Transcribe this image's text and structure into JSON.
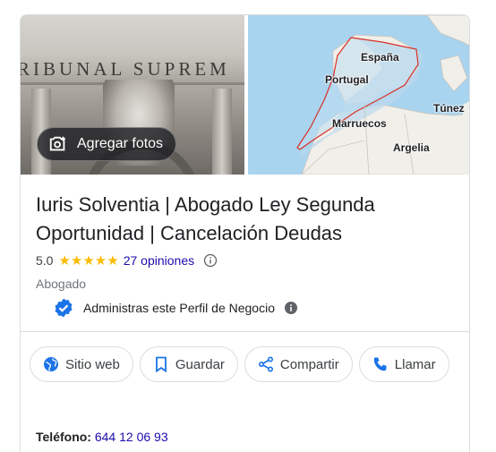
{
  "photos": {
    "left_inscription": "RIBUNAL SUPREM",
    "add_photos_label": "Agregar fotos"
  },
  "map": {
    "labels": {
      "spain": "España",
      "portugal": "Portugal",
      "morocco": "Marruecos",
      "tunisia": "Túnez",
      "algeria": "Argelia"
    },
    "colors": {
      "water": "#a9d4ef",
      "land": "#f1efe9",
      "region_outline": "#d93025"
    }
  },
  "business": {
    "title": "Iuris Solventia | Abogado Ley Segunda Oportunidad | Cancelación Deudas",
    "rating": "5.0",
    "stars": "★★★★★",
    "reviews": "27 opiniones",
    "category": "Abogado",
    "owner_notice": "Administras este Perfil de Negocio"
  },
  "actions": {
    "website": "Sitio web",
    "save": "Guardar",
    "share": "Compartir",
    "call": "Llamar"
  },
  "contact": {
    "phone_label": "Teléfono:",
    "phone_value": "644 12 06 93"
  },
  "colors": {
    "accent": "#1a73e8",
    "star": "#fbbc04",
    "link": "#1a0dab"
  }
}
